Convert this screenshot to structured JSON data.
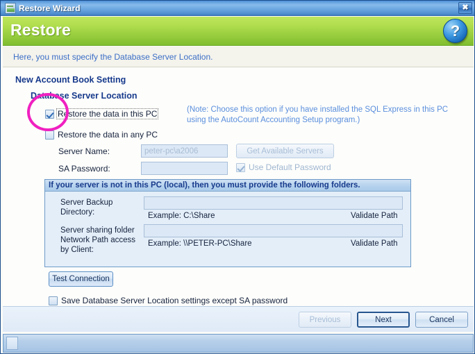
{
  "window": {
    "title": "Restore Wizard",
    "icon": "wizard-document-icon",
    "close_label": "✖"
  },
  "banner": {
    "title": "Restore",
    "help_icon": "help-question-icon",
    "help_label": "?"
  },
  "instruction": {
    "text": "Here, you must specify the Database Server Location."
  },
  "sections": {
    "new_account_book": "New Account Book Setting",
    "database_server_location": "Database Server Location"
  },
  "options": {
    "restore_this_pc": {
      "label": "Restore the data in this PC",
      "checked": true
    },
    "restore_any_pc": {
      "label": "Restore the data in any PC",
      "checked": false
    },
    "note": "(Note: Choose this option if you have installed the SQL Express in this PC using the AutoCount Accounting Setup program.)"
  },
  "fields": {
    "server_name_label": "Server Name:",
    "server_name_value": "peter-pc\\a2006",
    "sa_password_label": "SA Password:",
    "sa_password_value": "",
    "get_available_servers": "Get Available Servers",
    "use_default_password": {
      "label": "Use Default Password",
      "checked": true
    }
  },
  "panel": {
    "header": "If your server is not in this PC (local), then you must provide the following folders.",
    "rows": [
      {
        "label": "Server Backup Directory:",
        "value": "",
        "example": "Example: C:\\Share",
        "validate": "Validate Path"
      },
      {
        "label": "Server sharing folder Network Path access by Client:",
        "value": "",
        "example": "Example: \\\\PETER-PC\\Share",
        "validate": "Validate Path"
      }
    ]
  },
  "actions": {
    "test_connection": "Test Connection",
    "save_settings": {
      "label": "Save Database Server Location settings except SA password",
      "checked": false
    }
  },
  "footer": {
    "previous": "Previous",
    "next": "Next",
    "cancel": "Cancel"
  },
  "annotation": {
    "shape": "ellipse-highlight",
    "color": "#f020c0"
  },
  "colors": {
    "banner_green": "#a8d943",
    "title_blue": "#5f9edd",
    "link_blue": "#3b6ec6",
    "heading_navy": "#173a8c",
    "annotation_pink": "#f020c0"
  }
}
